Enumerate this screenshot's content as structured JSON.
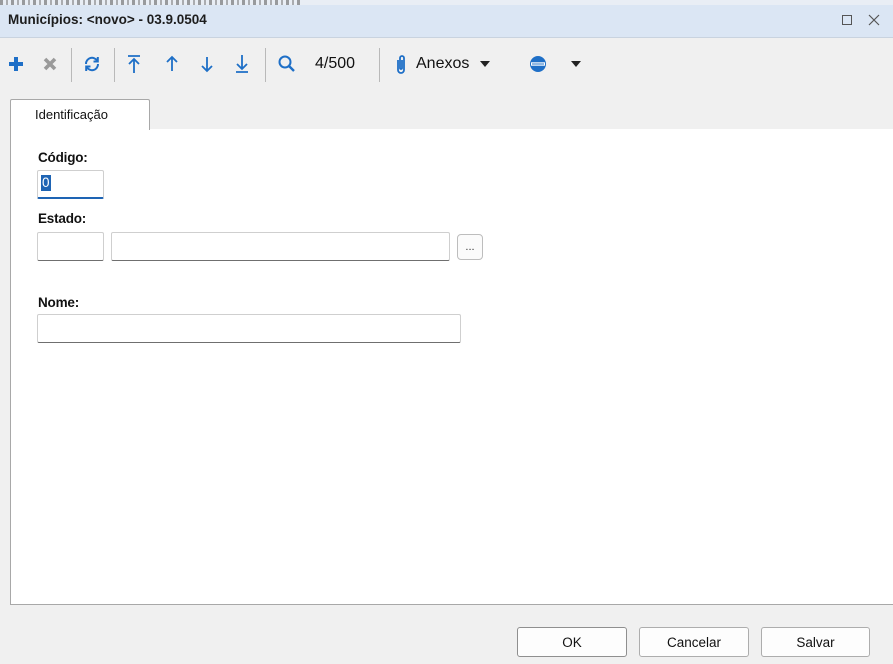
{
  "window": {
    "title": "Municípios: <novo> - 03.9.0504"
  },
  "toolbar": {
    "record_counter": "4/500",
    "anexos_label": "Anexos",
    "icons": [
      "add-icon",
      "delete-icon",
      "refresh-icon",
      "first-record-icon",
      "previous-record-icon",
      "next-record-icon",
      "last-record-icon",
      "search-icon",
      "paperclip-icon",
      "dropdown-arrow-icon",
      "options-icon",
      "dropdown-arrow-icon"
    ],
    "colors": {
      "add": "#1e6fc7",
      "delete": "#9a9a9a",
      "nav": "#1e6fc7"
    }
  },
  "tabs": [
    {
      "label": "Identificação",
      "active": true
    }
  ],
  "form": {
    "codigo": {
      "label": "Código:",
      "value": "0"
    },
    "estado": {
      "label": "Estado:",
      "code_value": "",
      "name_value": "",
      "lookup_label": "..."
    },
    "nome": {
      "label": "Nome:",
      "value": ""
    }
  },
  "footer": {
    "ok_label": "OK",
    "cancel_label": "Cancelar",
    "save_label": "Salvar"
  }
}
